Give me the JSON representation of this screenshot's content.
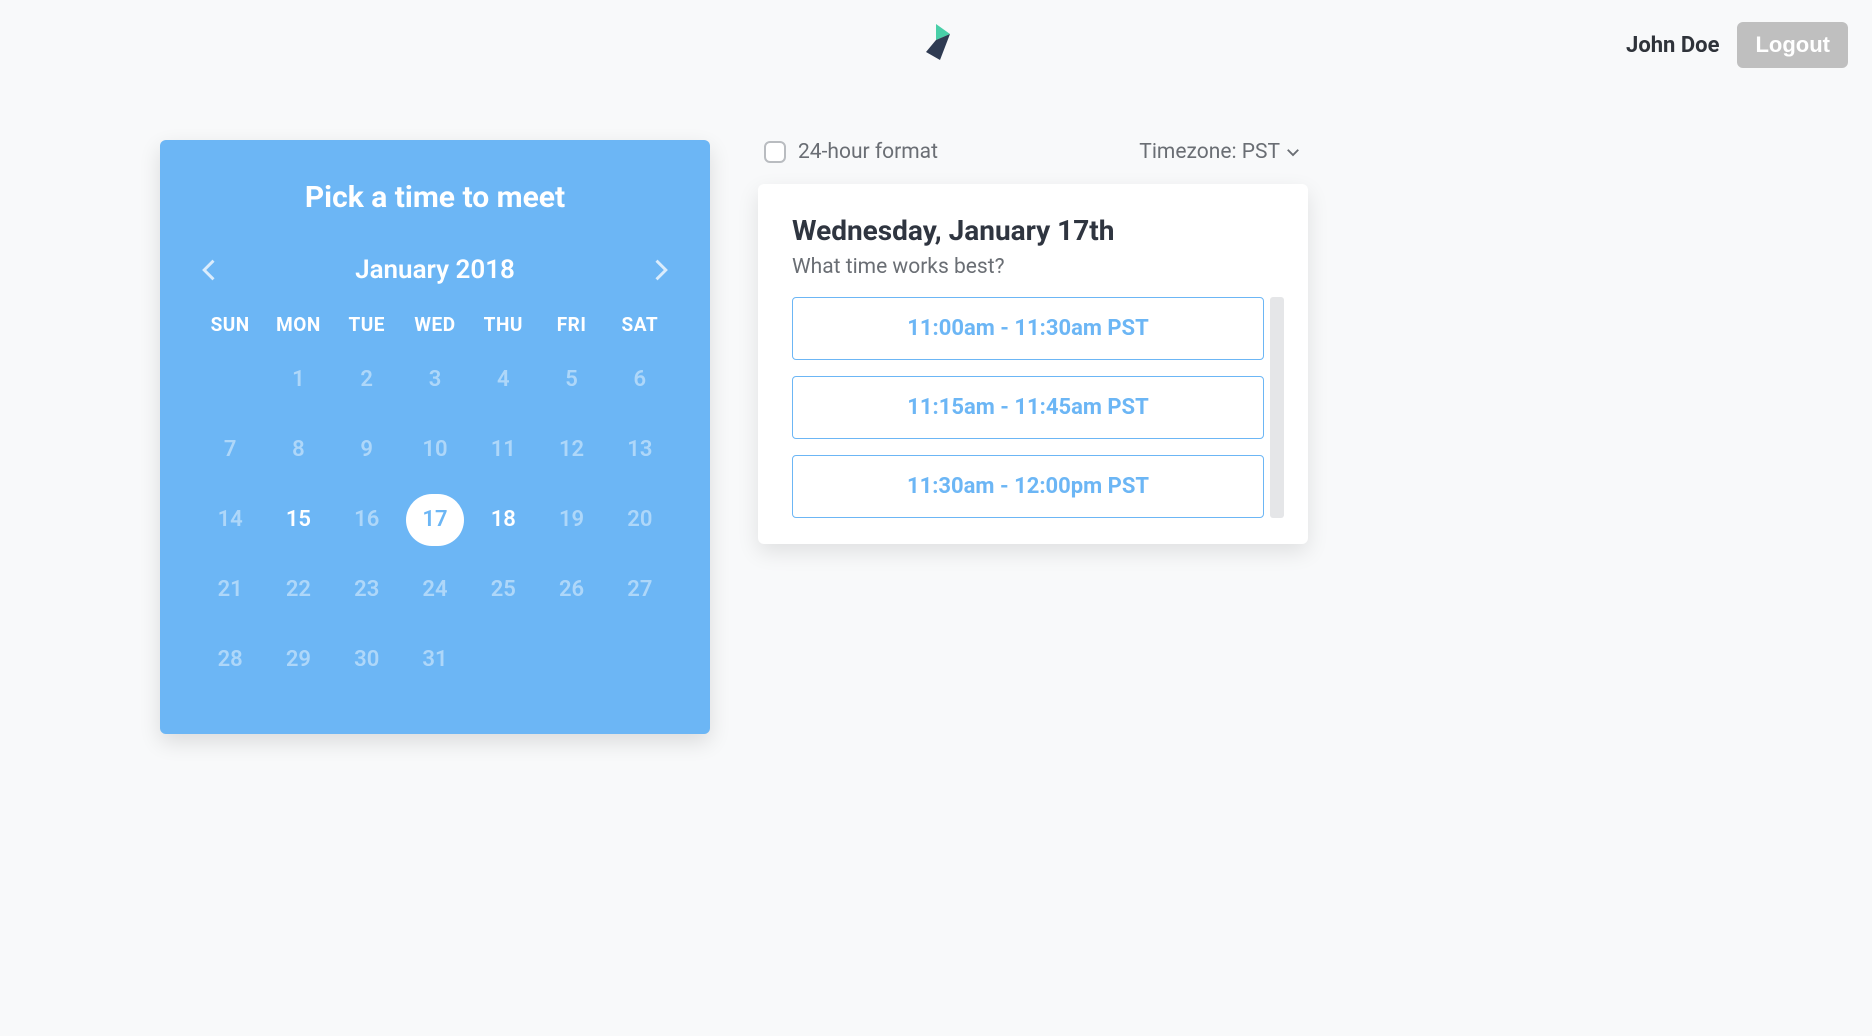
{
  "header": {
    "user_name": "John Doe",
    "logout_label": "Logout"
  },
  "calendar": {
    "title": "Pick a time to meet",
    "month_label": "January 2018",
    "dow": [
      "SUN",
      "MON",
      "TUE",
      "WED",
      "THU",
      "FRI",
      "SAT"
    ],
    "days": [
      {
        "n": "",
        "state": ""
      },
      {
        "n": "1",
        "state": "dim"
      },
      {
        "n": "2",
        "state": "dim"
      },
      {
        "n": "3",
        "state": "dim"
      },
      {
        "n": "4",
        "state": "dim"
      },
      {
        "n": "5",
        "state": "dim"
      },
      {
        "n": "6",
        "state": "dim"
      },
      {
        "n": "7",
        "state": "dim"
      },
      {
        "n": "8",
        "state": "dim"
      },
      {
        "n": "9",
        "state": "dim"
      },
      {
        "n": "10",
        "state": "dim"
      },
      {
        "n": "11",
        "state": "dim"
      },
      {
        "n": "12",
        "state": "dim"
      },
      {
        "n": "13",
        "state": "dim"
      },
      {
        "n": "14",
        "state": "dim"
      },
      {
        "n": "15",
        "state": "avail"
      },
      {
        "n": "16",
        "state": "dim"
      },
      {
        "n": "17",
        "state": "selected"
      },
      {
        "n": "18",
        "state": "avail"
      },
      {
        "n": "19",
        "state": "dim"
      },
      {
        "n": "20",
        "state": "dim"
      },
      {
        "n": "21",
        "state": "dim"
      },
      {
        "n": "22",
        "state": "dim"
      },
      {
        "n": "23",
        "state": "dim"
      },
      {
        "n": "24",
        "state": "dim"
      },
      {
        "n": "25",
        "state": "dim"
      },
      {
        "n": "26",
        "state": "dim"
      },
      {
        "n": "27",
        "state": "dim"
      },
      {
        "n": "28",
        "state": "dim"
      },
      {
        "n": "29",
        "state": "dim"
      },
      {
        "n": "30",
        "state": "dim"
      },
      {
        "n": "31",
        "state": "dim"
      },
      {
        "n": "",
        "state": ""
      },
      {
        "n": "",
        "state": ""
      },
      {
        "n": "",
        "state": ""
      }
    ]
  },
  "options": {
    "format_label": "24-hour format",
    "format_checked": false,
    "timezone_label": "Timezone: PST"
  },
  "slots": {
    "date_heading": "Wednesday, January 17th",
    "subheading": "What time works best?",
    "items": [
      "11:00am - 11:30am PST",
      "11:15am - 11:45am PST",
      "11:30am - 12:00pm PST"
    ]
  }
}
